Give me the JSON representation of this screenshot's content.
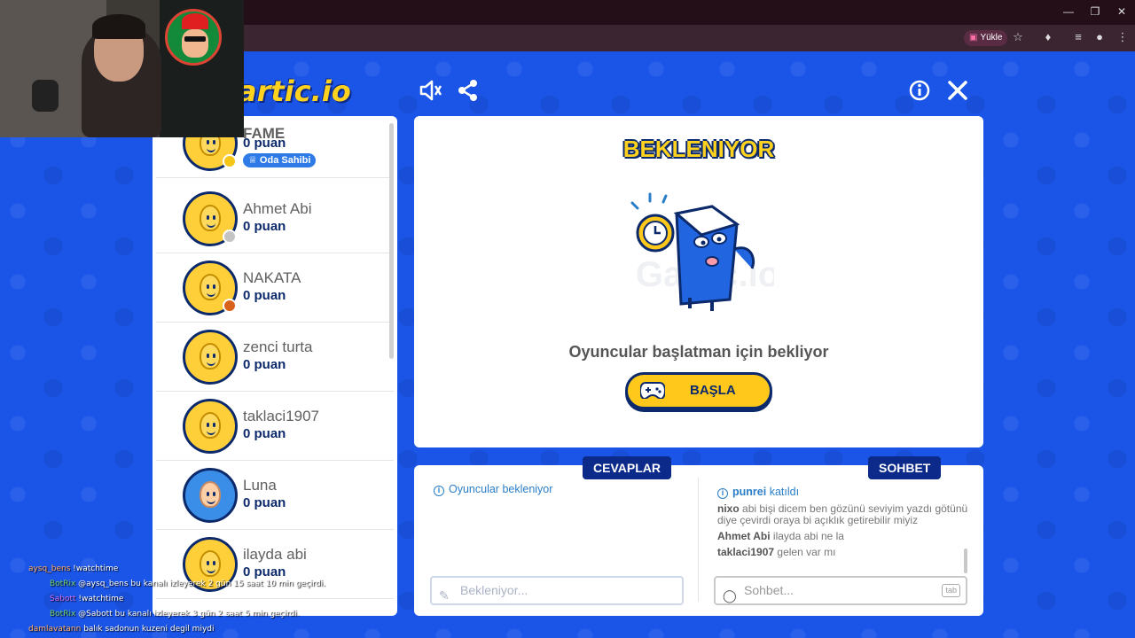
{
  "browser": {
    "upload_label": "Yükle",
    "window_controls": [
      "minimize-icon",
      "restore-icon",
      "close-icon"
    ]
  },
  "game": {
    "logo": "artic.io",
    "icons": [
      "speaker-icon",
      "share-icon",
      "info-icon",
      "close-icon"
    ]
  },
  "players": [
    {
      "name": "FAME",
      "score": "0 puan",
      "badge": "Oda Sahibi",
      "status_color": "#f5c518",
      "bold": true
    },
    {
      "name": "Ahmet Abi",
      "score": "0 puan",
      "status_color": "#c4c4c4"
    },
    {
      "name": "NAKATA",
      "score": "0 puan",
      "status_color": "#d9621a"
    },
    {
      "name": "zenci turta",
      "score": "0 puan"
    },
    {
      "name": "taklaci1907",
      "score": "0 puan"
    },
    {
      "name": "Luna",
      "score": "0 puan"
    },
    {
      "name": "ilayda abi",
      "score": "0 puan"
    }
  ],
  "main": {
    "title": "BEKLENIYOR",
    "watermark": "Gartic.io",
    "message": "Oyuncular başlatman için bekliyor",
    "start_button": "BAŞLA"
  },
  "answers": {
    "tab": "CEVAPLAR",
    "info": "Oyuncular bekleniyor",
    "placeholder": "Bekleniyor..."
  },
  "chat": {
    "tab": "SOHBET",
    "join_name": "punrei",
    "join_text": "katıldı",
    "messages": [
      {
        "user": "nixo",
        "text": "abi bişi dicem ben gözünü seviyim yazdı götünü diye çevirdi oraya bi açıklık getirebilir miyiz"
      },
      {
        "user": "Ahmet Abi",
        "text": "ilayda abi ne la"
      },
      {
        "user": "taklaci1907",
        "text": "gelen var mı"
      }
    ],
    "placeholder": "Sohbet...",
    "tab_key": "tab"
  },
  "stream_chat": [
    {
      "user": "aysq_bens",
      "text": "!watchtime"
    },
    {
      "user": "BotRix",
      "text": "@aysq_bens bu kanalı izleyerek 2 gün 15 saat 10 min geçirdi."
    },
    {
      "user": "Sabott",
      "text": "!watchtime"
    },
    {
      "user": "BotRix",
      "text": "@Sabott bu kanalı izleyerek 3 gün 2 saat 5 min geçirdi."
    },
    {
      "user": "damlavatann",
      "text": "balık sadonun kuzeni degil miydi"
    }
  ]
}
